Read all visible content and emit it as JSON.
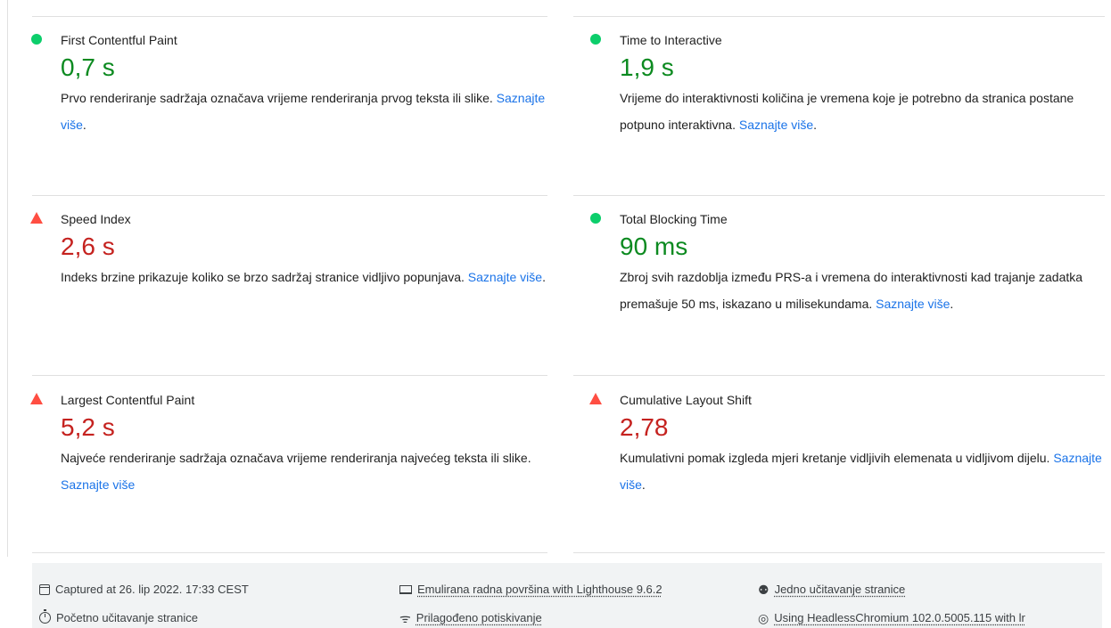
{
  "metrics": [
    {
      "title": "First Contentful Paint",
      "value": "0,7 s",
      "status": "pass",
      "desc": "Prvo renderiranje sadržaja označava vrijeme renderiranja prvog teksta ili slike.",
      "link": "Saznajte više",
      "after": "."
    },
    {
      "title": "Time to Interactive",
      "value": "1,9 s",
      "status": "pass",
      "desc": "Vrijeme do interaktivnosti količina je vremena koje je potrebno da stranica postane potpuno interaktivna.",
      "link": "Saznajte više",
      "after": "."
    },
    {
      "title": "Speed Index",
      "value": "2,6 s",
      "status": "fail",
      "desc": "Indeks brzine prikazuje koliko se brzo sadržaj stranice vidljivo popunjava.",
      "link": "Saznajte više",
      "after": "."
    },
    {
      "title": "Total Blocking Time",
      "value": "90 ms",
      "status": "pass",
      "desc": "Zbroj svih razdoblja između PRS-a i vremena do interaktivnosti kad trajanje zadatka premašuje 50 ms, iskazano u milisekundama.",
      "link": "Saznajte više",
      "after": "."
    },
    {
      "title": "Largest Contentful Paint",
      "value": "5,2 s",
      "status": "fail",
      "desc": "Najveće renderiranje sadržaja označava vrijeme renderiranja najvećeg teksta ili slike.",
      "link": "Saznajte više",
      "after": ""
    },
    {
      "title": "Cumulative Layout Shift",
      "value": "2,78",
      "status": "fail",
      "desc": "Kumulativni pomak izgleda mjeri kretanje vidljivih elemenata u vidljivom dijelu.",
      "link": "Saznajte više",
      "after": "."
    }
  ],
  "footer": {
    "captured": "Captured at 26. lip 2022. 17:33 CEST",
    "initial_load": "Početno učitavanje stranice",
    "emulated": "Emulirana radna površina with Lighthouse 9.6.2",
    "throttling": "Prilagođeno potiskivanje",
    "single_load": "Jedno učitavanje stranice",
    "browser": "Using HeadlessChromium 102.0.5005.115 with lr"
  },
  "icons": {
    "pass": "green-circle-icon",
    "fail": "red-triangle-icon"
  },
  "colors": {
    "pass": "#0cce6b",
    "pass_text": "#0c8a20",
    "fail": "#ff4e42",
    "fail_text": "#c5221f",
    "link": "#1a73e8"
  }
}
